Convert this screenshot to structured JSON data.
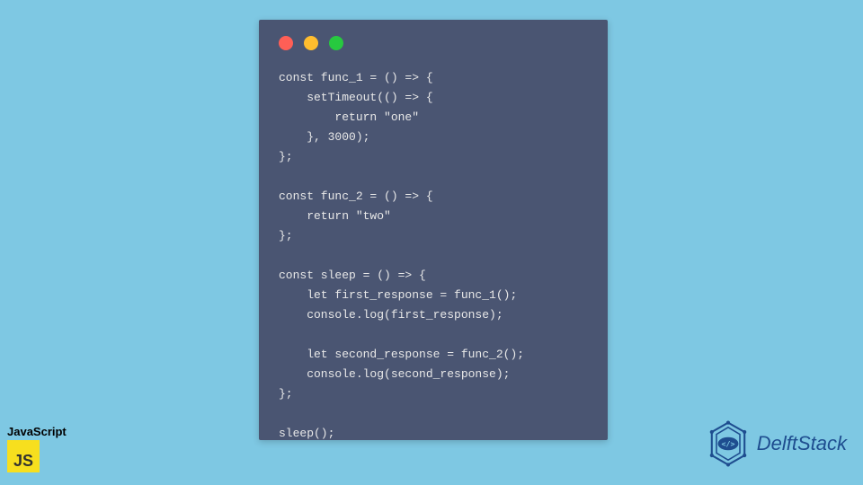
{
  "code": {
    "line1": "const func_1 = () => {",
    "line2": "    setTimeout(() => {",
    "line3": "        return \"one\"",
    "line4": "    }, 3000);",
    "line5": "};",
    "line6": "",
    "line7": "const func_2 = () => {",
    "line8": "    return \"two\"",
    "line9": "};",
    "line10": "",
    "line11": "const sleep = () => {",
    "line12": "    let first_response = func_1();",
    "line13": "    console.log(first_response);",
    "line14": "",
    "line15": "    let second_response = func_2();",
    "line16": "    console.log(second_response);",
    "line17": "};",
    "line18": "",
    "line19": "sleep();"
  },
  "jsBadge": {
    "label": "JavaScript",
    "logoText": "JS"
  },
  "brand": {
    "name": "DelftStack"
  }
}
